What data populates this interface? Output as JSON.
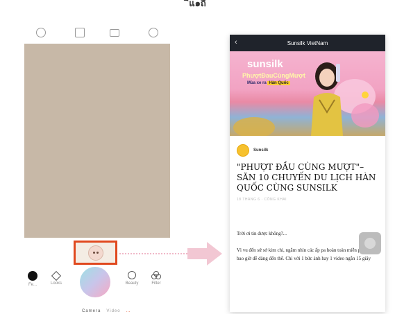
{
  "caption": "ิแ๑ถี",
  "camera": {
    "top_icons": [
      "circle-icon",
      "square-frame-icon",
      "grid-icon",
      "ring-icon"
    ],
    "controls": {
      "left1_label": "Fe...",
      "looks_label": "Looks",
      "beauty_label": "Beauty",
      "filter_label": "Filter"
    },
    "modes": [
      "Camera",
      "Video",
      "…"
    ]
  },
  "phone": {
    "header_title": "Sunsilk VietNam",
    "banner": {
      "brand": "sunsilk",
      "slogan": "PhượtĐauCùngMượt",
      "sub_left": "Mùa xe ra",
      "sub_highlight": "Hàn Quốc"
    },
    "author": "Sunsilk",
    "headline": "\"PHƯỢT ĐẦU CÙNG MƯỢT\"– SĂN 10 CHUYẾN DU LỊCH HÀN QUỐC CÙNG SUNSILK",
    "meta": "18 THÁNG 6 · CÔNG KHAI",
    "paragraph1": "Trời ơi tin được không?...",
    "paragraph2": "Vì vu đến sứ sở kim chi, ngắm nhìn các ấp pa hoàn toàn miễn phí chưa bao giờ dễ dàng đến thế. Chỉ với 1 bức ảnh hay 1 video ngắn 15 giây"
  },
  "colors": {
    "highlight_border": "#e0491f",
    "phone_header_bg": "#1f232b",
    "arrow": "#f2c7d3"
  }
}
